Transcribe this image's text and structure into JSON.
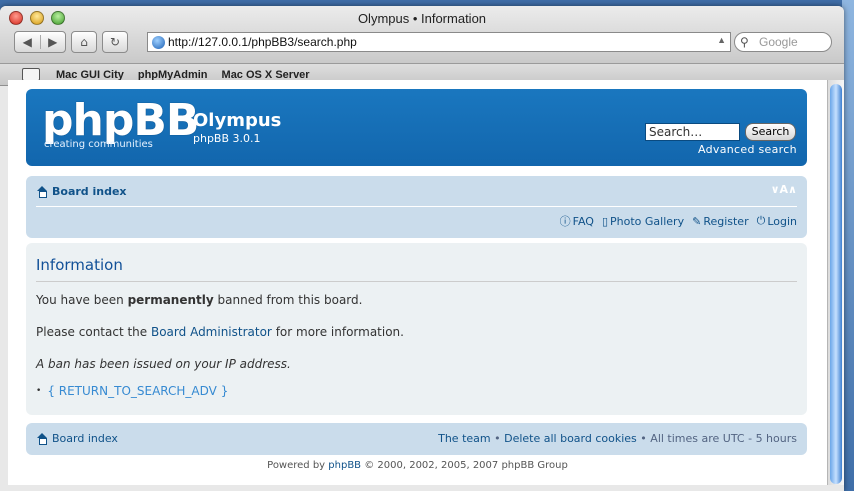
{
  "browser": {
    "title": "Olympus • Information",
    "url": "http://127.0.0.1/phpBB3/search.php",
    "search_placeholder": "Google",
    "bookmarks": [
      "Mac GUI City",
      "phpMyAdmin",
      "Mac OS X Server"
    ]
  },
  "header": {
    "logo_text": "phpBB",
    "logo_tagline": "creating   communities",
    "site_name": "Olympus",
    "version": "phpBB 3.0.1",
    "search_placeholder": "Search…",
    "search_button": "Search",
    "advanced_search": "Advanced search"
  },
  "navbar": {
    "board_index": "Board index",
    "font_size": "∨A∧",
    "links": {
      "faq": "FAQ",
      "gallery": "Photo Gallery",
      "register": "Register",
      "login": "Login"
    }
  },
  "panel": {
    "title": "Information",
    "line1_pre": "You have been ",
    "line1_bold": "permanently",
    "line1_post": " banned from this board.",
    "line2_pre": "Please contact the ",
    "line2_link": "Board Administrator",
    "line2_post": " for more information.",
    "line3": "A ban has been issued on your IP address.",
    "return_link": "{ RETURN_TO_SEARCH_ADV }"
  },
  "footer": {
    "board_index": "Board index",
    "team": "The team",
    "delete_cookies": "Delete all board cookies",
    "timezone": "All times are UTC - 5 hours",
    "powered_pre": "Powered by ",
    "powered_link": "phpBB",
    "powered_post": " © 2000, 2002, 2005, 2007 phpBB Group"
  }
}
